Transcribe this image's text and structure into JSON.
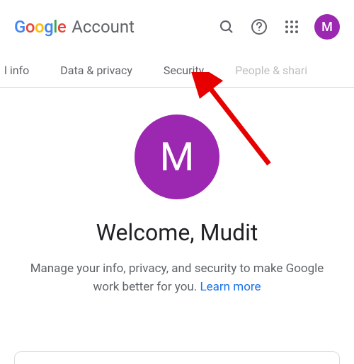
{
  "header": {
    "account_label": "Account",
    "avatar_initial": "M"
  },
  "tabs": {
    "items": [
      "l info",
      "Data & privacy",
      "Security",
      "People & shari"
    ]
  },
  "main": {
    "avatar_initial": "M",
    "welcome": "Welcome, Mudit",
    "subtext": "Manage your info, privacy, and security to make Google work better for you. ",
    "learn_more": "Learn more"
  },
  "annotation": {
    "arrow_target": "security-tab"
  }
}
